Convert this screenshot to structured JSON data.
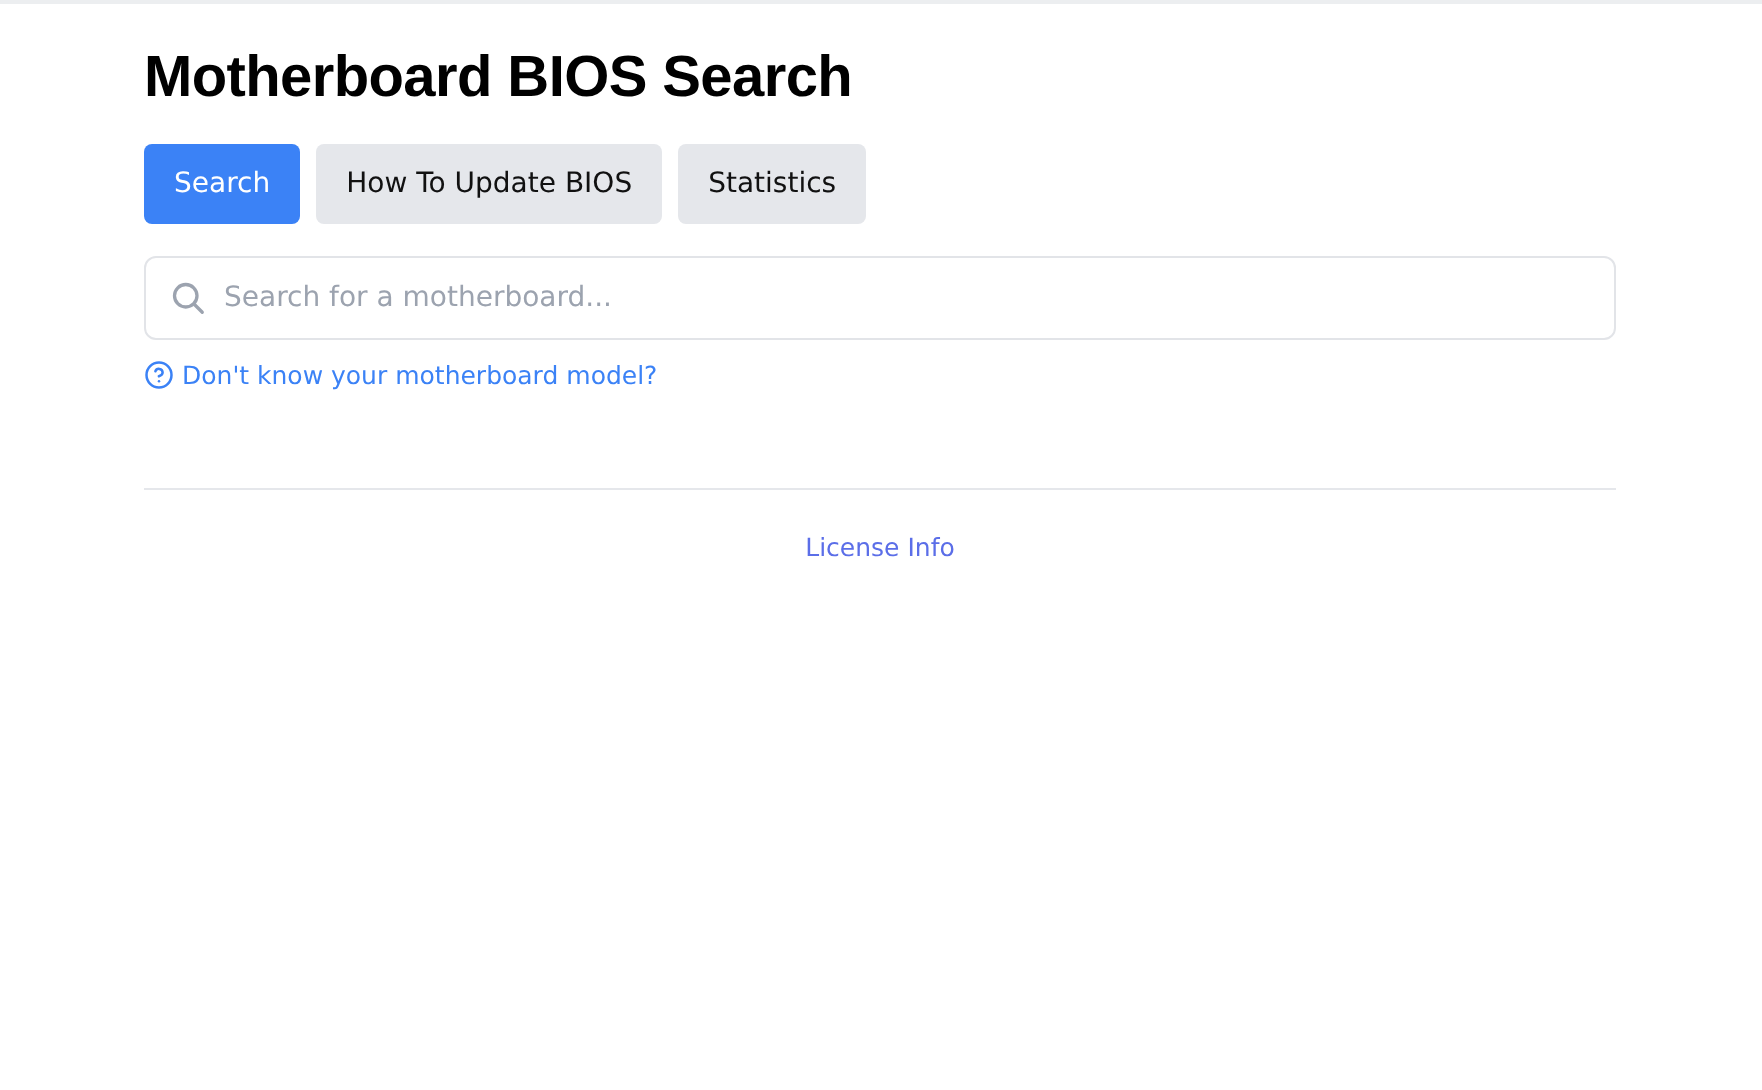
{
  "title": "Motherboard BIOS Search",
  "tabs": [
    {
      "label": "Search",
      "selected": true
    },
    {
      "label": "How To Update BIOS",
      "selected": false
    },
    {
      "label": "Statistics",
      "selected": false
    }
  ],
  "search": {
    "placeholder": "Search for a motherboard..."
  },
  "help_link": "Don't know your motherboard model?",
  "footer_link": "License Info"
}
